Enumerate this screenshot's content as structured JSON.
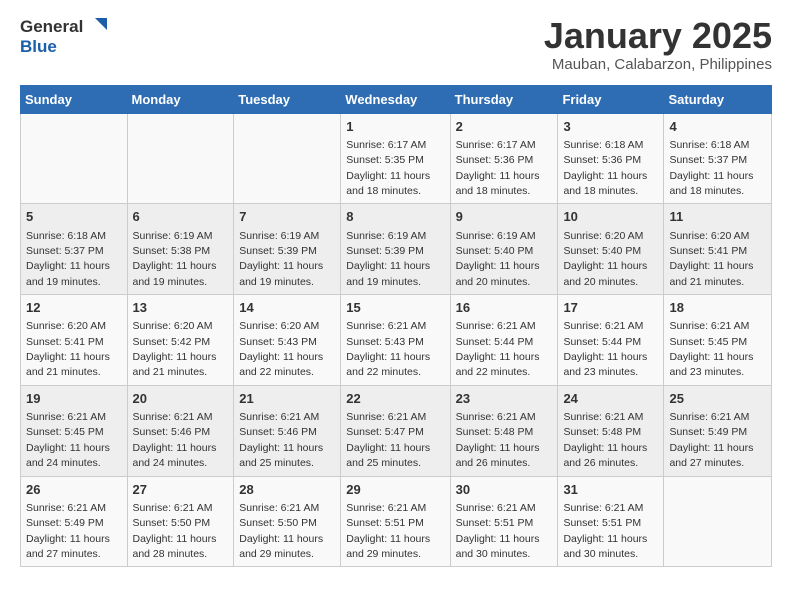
{
  "logo": {
    "general": "General",
    "blue": "Blue"
  },
  "header": {
    "month": "January 2025",
    "location": "Mauban, Calabarzon, Philippines"
  },
  "weekdays": [
    "Sunday",
    "Monday",
    "Tuesday",
    "Wednesday",
    "Thursday",
    "Friday",
    "Saturday"
  ],
  "weeks": [
    [
      {
        "day": "",
        "sunrise": "",
        "sunset": "",
        "daylight": ""
      },
      {
        "day": "",
        "sunrise": "",
        "sunset": "",
        "daylight": ""
      },
      {
        "day": "",
        "sunrise": "",
        "sunset": "",
        "daylight": ""
      },
      {
        "day": "1",
        "sunrise": "Sunrise: 6:17 AM",
        "sunset": "Sunset: 5:35 PM",
        "daylight": "Daylight: 11 hours and 18 minutes."
      },
      {
        "day": "2",
        "sunrise": "Sunrise: 6:17 AM",
        "sunset": "Sunset: 5:36 PM",
        "daylight": "Daylight: 11 hours and 18 minutes."
      },
      {
        "day": "3",
        "sunrise": "Sunrise: 6:18 AM",
        "sunset": "Sunset: 5:36 PM",
        "daylight": "Daylight: 11 hours and 18 minutes."
      },
      {
        "day": "4",
        "sunrise": "Sunrise: 6:18 AM",
        "sunset": "Sunset: 5:37 PM",
        "daylight": "Daylight: 11 hours and 18 minutes."
      }
    ],
    [
      {
        "day": "5",
        "sunrise": "Sunrise: 6:18 AM",
        "sunset": "Sunset: 5:37 PM",
        "daylight": "Daylight: 11 hours and 19 minutes."
      },
      {
        "day": "6",
        "sunrise": "Sunrise: 6:19 AM",
        "sunset": "Sunset: 5:38 PM",
        "daylight": "Daylight: 11 hours and 19 minutes."
      },
      {
        "day": "7",
        "sunrise": "Sunrise: 6:19 AM",
        "sunset": "Sunset: 5:39 PM",
        "daylight": "Daylight: 11 hours and 19 minutes."
      },
      {
        "day": "8",
        "sunrise": "Sunrise: 6:19 AM",
        "sunset": "Sunset: 5:39 PM",
        "daylight": "Daylight: 11 hours and 19 minutes."
      },
      {
        "day": "9",
        "sunrise": "Sunrise: 6:19 AM",
        "sunset": "Sunset: 5:40 PM",
        "daylight": "Daylight: 11 hours and 20 minutes."
      },
      {
        "day": "10",
        "sunrise": "Sunrise: 6:20 AM",
        "sunset": "Sunset: 5:40 PM",
        "daylight": "Daylight: 11 hours and 20 minutes."
      },
      {
        "day": "11",
        "sunrise": "Sunrise: 6:20 AM",
        "sunset": "Sunset: 5:41 PM",
        "daylight": "Daylight: 11 hours and 21 minutes."
      }
    ],
    [
      {
        "day": "12",
        "sunrise": "Sunrise: 6:20 AM",
        "sunset": "Sunset: 5:41 PM",
        "daylight": "Daylight: 11 hours and 21 minutes."
      },
      {
        "day": "13",
        "sunrise": "Sunrise: 6:20 AM",
        "sunset": "Sunset: 5:42 PM",
        "daylight": "Daylight: 11 hours and 21 minutes."
      },
      {
        "day": "14",
        "sunrise": "Sunrise: 6:20 AM",
        "sunset": "Sunset: 5:43 PM",
        "daylight": "Daylight: 11 hours and 22 minutes."
      },
      {
        "day": "15",
        "sunrise": "Sunrise: 6:21 AM",
        "sunset": "Sunset: 5:43 PM",
        "daylight": "Daylight: 11 hours and 22 minutes."
      },
      {
        "day": "16",
        "sunrise": "Sunrise: 6:21 AM",
        "sunset": "Sunset: 5:44 PM",
        "daylight": "Daylight: 11 hours and 22 minutes."
      },
      {
        "day": "17",
        "sunrise": "Sunrise: 6:21 AM",
        "sunset": "Sunset: 5:44 PM",
        "daylight": "Daylight: 11 hours and 23 minutes."
      },
      {
        "day": "18",
        "sunrise": "Sunrise: 6:21 AM",
        "sunset": "Sunset: 5:45 PM",
        "daylight": "Daylight: 11 hours and 23 minutes."
      }
    ],
    [
      {
        "day": "19",
        "sunrise": "Sunrise: 6:21 AM",
        "sunset": "Sunset: 5:45 PM",
        "daylight": "Daylight: 11 hours and 24 minutes."
      },
      {
        "day": "20",
        "sunrise": "Sunrise: 6:21 AM",
        "sunset": "Sunset: 5:46 PM",
        "daylight": "Daylight: 11 hours and 24 minutes."
      },
      {
        "day": "21",
        "sunrise": "Sunrise: 6:21 AM",
        "sunset": "Sunset: 5:46 PM",
        "daylight": "Daylight: 11 hours and 25 minutes."
      },
      {
        "day": "22",
        "sunrise": "Sunrise: 6:21 AM",
        "sunset": "Sunset: 5:47 PM",
        "daylight": "Daylight: 11 hours and 25 minutes."
      },
      {
        "day": "23",
        "sunrise": "Sunrise: 6:21 AM",
        "sunset": "Sunset: 5:48 PM",
        "daylight": "Daylight: 11 hours and 26 minutes."
      },
      {
        "day": "24",
        "sunrise": "Sunrise: 6:21 AM",
        "sunset": "Sunset: 5:48 PM",
        "daylight": "Daylight: 11 hours and 26 minutes."
      },
      {
        "day": "25",
        "sunrise": "Sunrise: 6:21 AM",
        "sunset": "Sunset: 5:49 PM",
        "daylight": "Daylight: 11 hours and 27 minutes."
      }
    ],
    [
      {
        "day": "26",
        "sunrise": "Sunrise: 6:21 AM",
        "sunset": "Sunset: 5:49 PM",
        "daylight": "Daylight: 11 hours and 27 minutes."
      },
      {
        "day": "27",
        "sunrise": "Sunrise: 6:21 AM",
        "sunset": "Sunset: 5:50 PM",
        "daylight": "Daylight: 11 hours and 28 minutes."
      },
      {
        "day": "28",
        "sunrise": "Sunrise: 6:21 AM",
        "sunset": "Sunset: 5:50 PM",
        "daylight": "Daylight: 11 hours and 29 minutes."
      },
      {
        "day": "29",
        "sunrise": "Sunrise: 6:21 AM",
        "sunset": "Sunset: 5:51 PM",
        "daylight": "Daylight: 11 hours and 29 minutes."
      },
      {
        "day": "30",
        "sunrise": "Sunrise: 6:21 AM",
        "sunset": "Sunset: 5:51 PM",
        "daylight": "Daylight: 11 hours and 30 minutes."
      },
      {
        "day": "31",
        "sunrise": "Sunrise: 6:21 AM",
        "sunset": "Sunset: 5:51 PM",
        "daylight": "Daylight: 11 hours and 30 minutes."
      },
      {
        "day": "",
        "sunrise": "",
        "sunset": "",
        "daylight": ""
      }
    ]
  ]
}
